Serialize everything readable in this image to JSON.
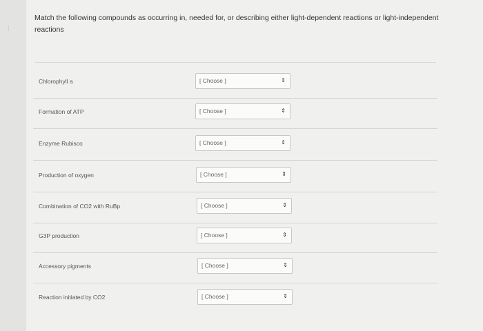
{
  "question": {
    "prompt": "Match the following compounds as occurring in, needed for, or describing either light-dependent reactions or light-independent reactions"
  },
  "rows": [
    {
      "label": "Chlorophyll a",
      "select": "[ Choose ]"
    },
    {
      "label": "Formation of ATP",
      "select": "[ Choose ]"
    },
    {
      "label": "Enzyme Rubisco",
      "select": "[ Choose ]"
    },
    {
      "label": "Production of oxygen",
      "select": "[ Choose ]"
    },
    {
      "label": "Combination of CO2 with RuBp",
      "select": "[ Choose ]"
    },
    {
      "label": "G3P production",
      "select": "[ Choose ]"
    },
    {
      "label": "Accessory pigments",
      "select": "[ Choose ]"
    },
    {
      "label": "Reaction initiated by CO2",
      "select": "[ Choose ]"
    }
  ],
  "icons": {
    "dropdown": "chevron-updown-icon"
  }
}
